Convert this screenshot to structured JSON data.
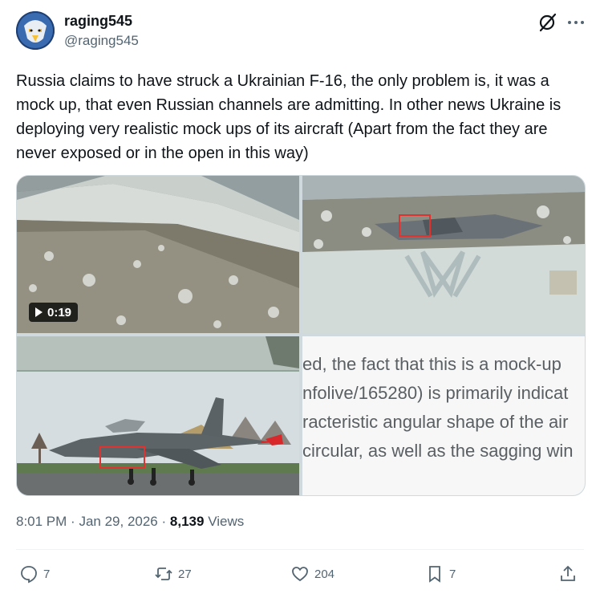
{
  "author": {
    "display_name": "raging545",
    "handle": "@raging545"
  },
  "tweet": {
    "text": "Russia claims to have struck a Ukrainian F-16, the only problem is, it was a mock up, that even Russian channels are admitting. In other news Ukraine is deploying very realistic mock ups of its aircraft (Apart from the fact they are never exposed or in the open in this way)"
  },
  "media": {
    "video_duration": "0:19",
    "overlay_lines": [
      "ed, the fact that this is a mock-up",
      "nfolive/165280) is primarily indicat",
      "racteristic angular shape of the air",
      "circular, as well as the sagging win"
    ]
  },
  "meta": {
    "time": "8:01 PM",
    "separator": "·",
    "date": "Jan 29, 2026",
    "views_count": "8,139",
    "views_label": "Views"
  },
  "actions": {
    "replies": "7",
    "reposts": "27",
    "likes": "204",
    "bookmarks": "7"
  },
  "icons": [
    "grok-icon",
    "more-icon",
    "play-icon",
    "reply-icon",
    "repost-icon",
    "like-icon",
    "bookmark-icon",
    "share-icon"
  ],
  "colors": {
    "text": "#0f1419",
    "secondary": "#536471",
    "border": "#cfd9de",
    "highlight_box": "#e0322e"
  }
}
